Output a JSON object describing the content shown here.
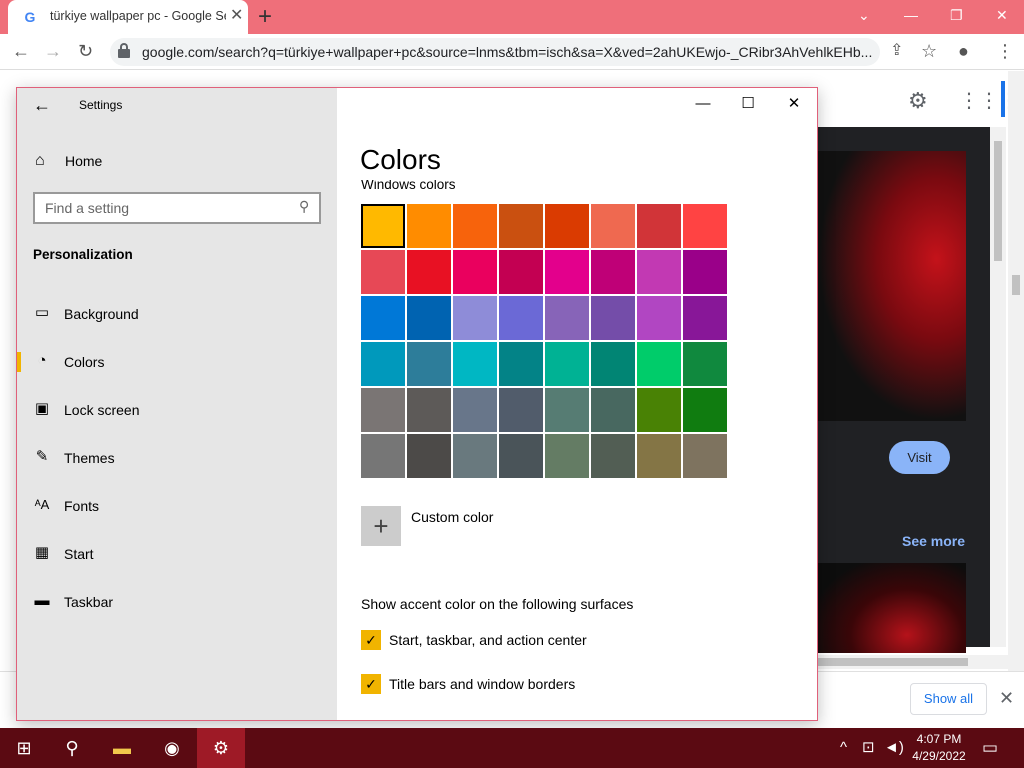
{
  "browser": {
    "tab_title": "türkiye wallpaper pc - Google Se",
    "tab_favicon": "G",
    "url": "google.com/search?q=türkiye+wallpaper+pc&source=lnms&tbm=isch&sa=X&ved=2ahUKEwjo-_CRibr3AhVehlkEHb...",
    "accent_color": "#ef6f7a"
  },
  "google_page": {
    "visit_label": "Visit",
    "see_more_label": "See more",
    "show_all_label": "Show all"
  },
  "settings": {
    "window_title": "Settings",
    "home_label": "Home",
    "search_placeholder": "Find a setting",
    "section_header": "Personalization",
    "nav_items": [
      {
        "label": "Background",
        "icon": "background-icon"
      },
      {
        "label": "Colors",
        "icon": "palette-icon",
        "selected": true
      },
      {
        "label": "Lock screen",
        "icon": "lock-screen-icon"
      },
      {
        "label": "Themes",
        "icon": "themes-icon"
      },
      {
        "label": "Fonts",
        "icon": "fonts-icon"
      },
      {
        "label": "Start",
        "icon": "start-icon"
      },
      {
        "label": "Taskbar",
        "icon": "taskbar-icon"
      }
    ],
    "page_title": "Colors",
    "windows_colors_header": "Windows colors",
    "swatches": [
      [
        "#FFB900",
        "#FF8C00",
        "#F7630C",
        "#CA5010",
        "#DA3B01",
        "#EF6950",
        "#D13438",
        "#FF4343"
      ],
      [
        "#E74856",
        "#E81123",
        "#EA005E",
        "#C30052",
        "#E3008C",
        "#BF0077",
        "#C239B3",
        "#9A0089"
      ],
      [
        "#0078D7",
        "#0063B1",
        "#8E8CD8",
        "#6B69D6",
        "#8764B8",
        "#744DA9",
        "#B146C2",
        "#881798"
      ],
      [
        "#0099BC",
        "#2D7D9A",
        "#00B7C3",
        "#038387",
        "#00B294",
        "#018574",
        "#00CC6A",
        "#10893E"
      ],
      [
        "#7A7574",
        "#5D5A58",
        "#68768A",
        "#515C6B",
        "#567C73",
        "#486860",
        "#498205",
        "#107C10"
      ],
      [
        "#767676",
        "#4C4A48",
        "#69797E",
        "#4A5459",
        "#647C64",
        "#525E54",
        "#847545",
        "#7E735F"
      ]
    ],
    "selected_swatch": "#FFB900",
    "custom_color_label": "Custom color",
    "surfaces_header": "Show accent color on the following surfaces",
    "checkboxes": [
      {
        "label": "Start, taskbar, and action center",
        "checked": true
      },
      {
        "label": "Title bars and window borders",
        "checked": true
      }
    ]
  },
  "taskbar": {
    "time": "4:07 PM",
    "date": "4/29/2022",
    "color": "#5b0a12"
  }
}
